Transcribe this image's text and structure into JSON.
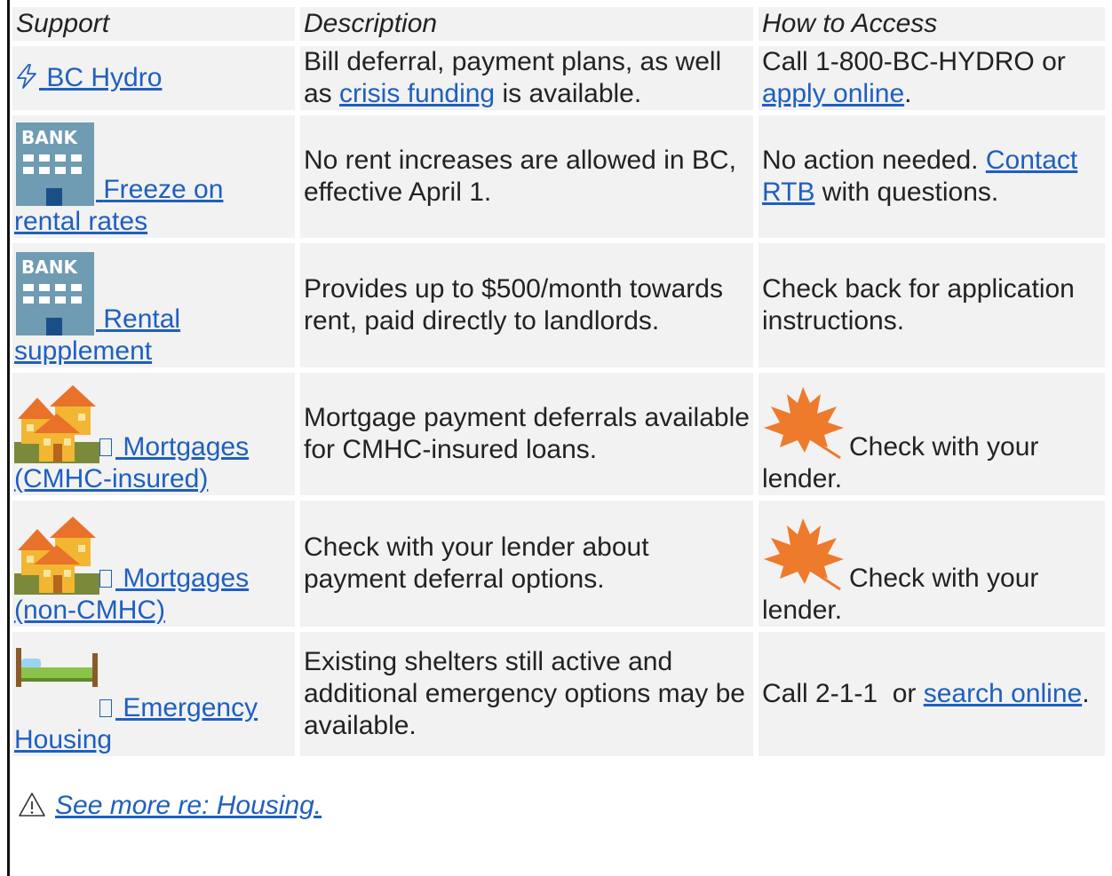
{
  "table": {
    "headers": [
      "Support",
      "Description",
      "How to Access"
    ],
    "rows": [
      {
        "icon": "lightning-icon",
        "support": "BC Hydro",
        "description_pre": "Bill deferral, payment plans, as well as ",
        "description_link": "crisis funding",
        "description_post": " is available.",
        "access_pre": "Call 1-800-BC-HYDRO or ",
        "access_link": "apply online",
        "access_post": "."
      },
      {
        "icon": "bank-icon",
        "support": "Freeze on rental rates",
        "description": "No rent increases are allowed in BC, effective April 1.",
        "access_pre": "No action needed. ",
        "access_link": "Contact RTB",
        "access_post": " with questions."
      },
      {
        "icon": "bank-icon",
        "support": "Rental supplement",
        "description": "Provides up to $500/month towards rent, paid directly to landlords.",
        "access": "Check back for application instructions."
      },
      {
        "icon": "houses-icon",
        "support": "Mortgages (CMHC-insured)",
        "description": "Mortgage payment deferrals available for CMHC-insured loans.",
        "access_icon": "maple-leaf-icon",
        "access": "Check with your lender."
      },
      {
        "icon": "houses-icon",
        "support": "Mortgages (non-CMHC)",
        "description": "Check with your lender about payment deferral options.",
        "access_icon": "maple-leaf-icon",
        "access": "Check with your lender."
      },
      {
        "icon": "bed-icon",
        "support": "Emergency Housing",
        "description": "Existing shelters still active and additional emergency options may be available.",
        "access_pre": "Call 2-1-1  or ",
        "access_link": "search online",
        "access_post": "."
      }
    ]
  },
  "footer": {
    "icon": "warning-icon",
    "link": "See more re: Housing."
  },
  "colors": {
    "link": "#1f5fbf",
    "cell_bg": "#f2f2f2",
    "text": "#222222"
  }
}
